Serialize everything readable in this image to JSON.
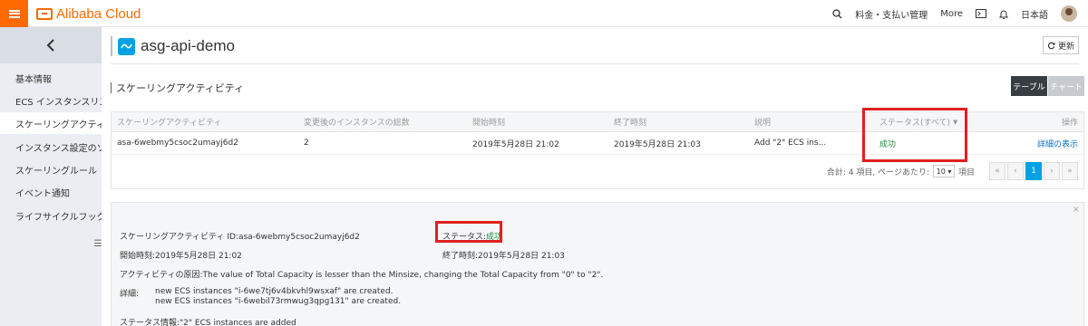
{
  "header": {
    "brand": "Alibaba Cloud",
    "nav": [
      "料金・支払い管理",
      "More",
      "日本語"
    ]
  },
  "sidebar": {
    "items": [
      "基本情報",
      "ECS インスタンスリスト",
      "スケーリングアクティ…",
      "インスタンス設定のソ…",
      "スケーリングルール",
      "イベント通知",
      "ライフサイクルフック"
    ]
  },
  "main": {
    "title": "asg-api-demo",
    "refresh_label": "更新",
    "section_title": "スケーリングアクティビティ",
    "view_table": "テーブル",
    "view_chart": "チャート"
  },
  "table": {
    "headers": [
      "スケーリングアクティビティ",
      "変更後のインスタンスの総数",
      "開始時刻",
      "終了時刻",
      "説明",
      "ステータス(すべて)",
      "操作"
    ],
    "row": [
      "asa-6webmy5csoc2umayj6d2",
      "2",
      "2019年5月28日 21:02",
      "2019年5月28日 21:03",
      "Add \"2\" ECS ins...",
      "成功",
      "詳細の表示"
    ]
  },
  "pager": {
    "summary": "合計: 4 項目, ページあたり:",
    "per_page": "10",
    "unit": "項目",
    "current_page": "1"
  },
  "detail": {
    "activity_id": "スケーリングアクティビティ ID:asa-6webmy5csoc2umayj6d2",
    "status_label": "ステータス:",
    "status_value": "成功",
    "start": "開始時刻:2019年5月28日 21:02",
    "end": "終了時刻:2019年5月28日 21:03",
    "cause": "アクティビティの原因:The value of Total Capacity is lesser than the Minsize, changing the Total Capacity from \"0\" to \"2\".",
    "details_label": "詳細:",
    "details_line1": "new ECS instances \"i-6we7tj6v4bkvhl9wsxaf\" are created.",
    "details_line2": "new ECS instances \"i-6webil73rmwug3qpg131\" are created.",
    "status_info": "ステータス情報:\"2\" ECS instances are added"
  },
  "colors": {
    "brand": "#ff6a00",
    "success": "#1e8e3e",
    "highlight": "#e0201e",
    "link": "#0070cc"
  }
}
